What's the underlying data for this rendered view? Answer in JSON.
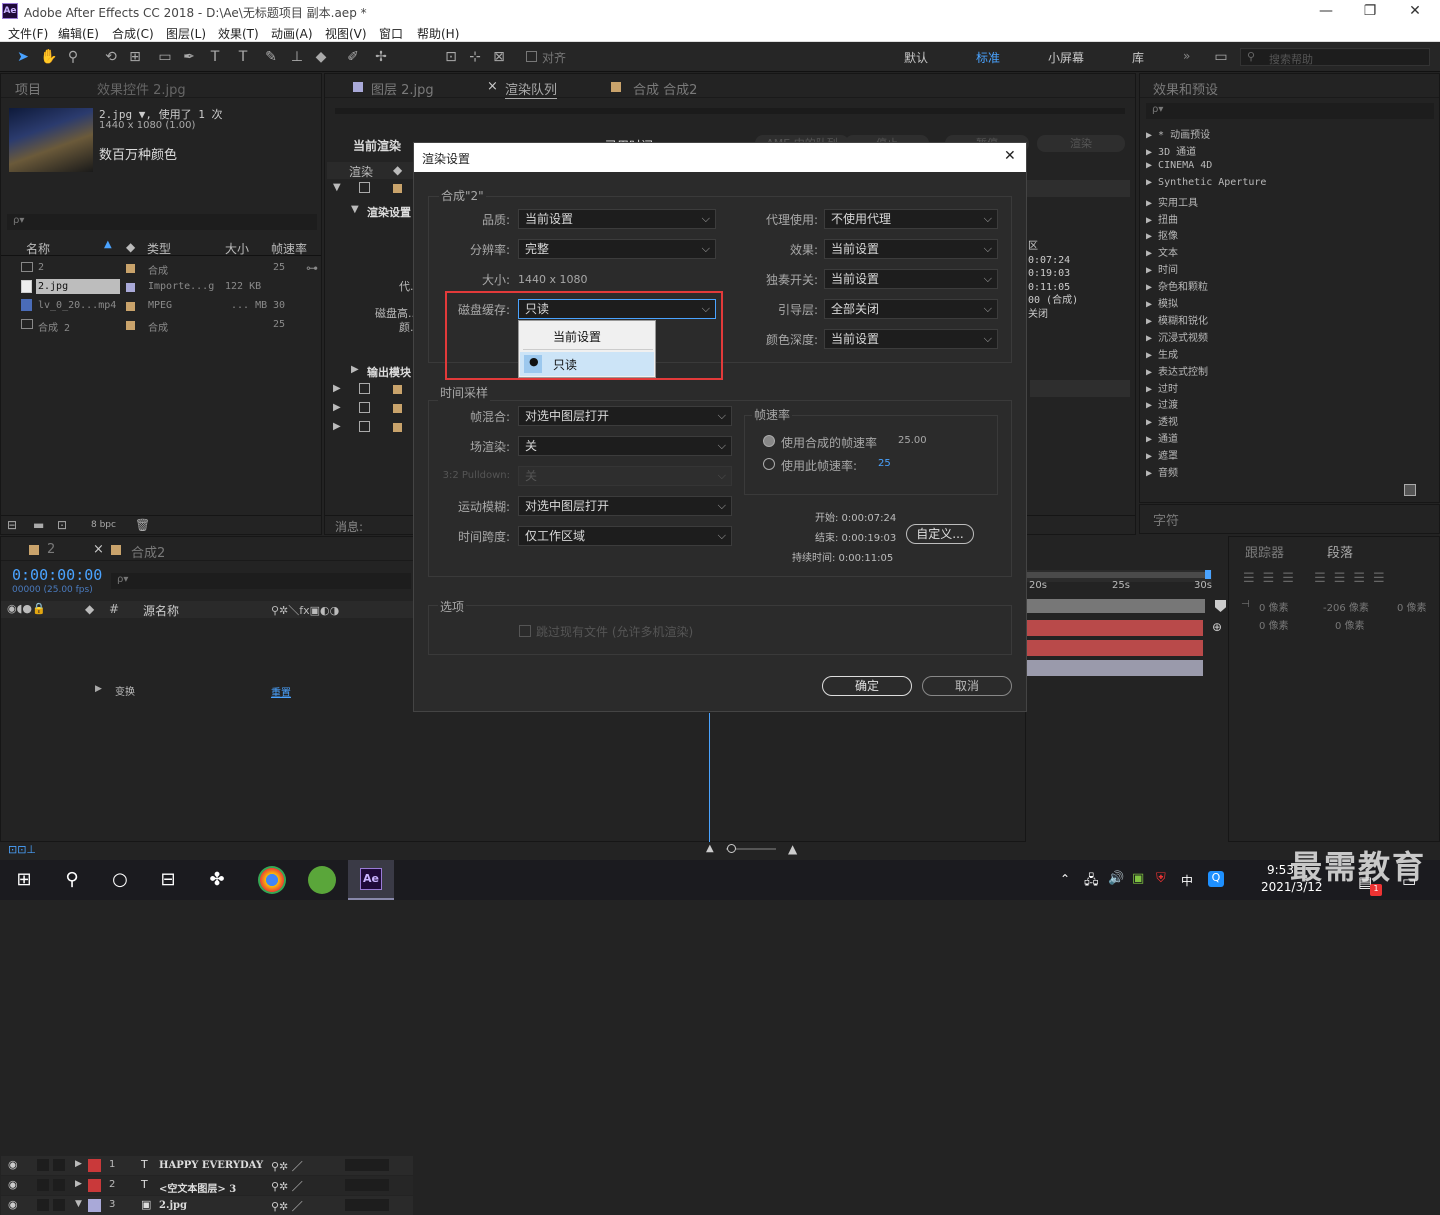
{
  "window": {
    "title": "Adobe After Effects CC 2018 - D:\\Ae\\无标题项目 副本.aep *",
    "app_icon": "Ae",
    "min": "—",
    "restore": "❐",
    "close": "✕"
  },
  "menu": [
    "文件(F)",
    "编辑(E)",
    "合成(C)",
    "图层(L)",
    "效果(T)",
    "动画(A)",
    "视图(V)",
    "窗口",
    "帮助(H)"
  ],
  "toolbar": {
    "align_label": "对齐",
    "workspaces": [
      "默认",
      "标准",
      "小屏幕",
      "库"
    ],
    "search_placeholder": "搜索帮助",
    "more": "»"
  },
  "project": {
    "tabs": [
      "项目",
      "效果控件 2.jpg"
    ],
    "file_name": "2.jpg ▼, 使用了 1 次",
    "file_size": "1440 x 1080 (1.00)",
    "file_colors": "数百万种颜色",
    "search_placeholder": "ρ▾",
    "columns": [
      "名称",
      "类型",
      "大小",
      "帧速率"
    ],
    "items": [
      {
        "name": "2",
        "type": "合成",
        "size": "",
        "fps": "25",
        "color": "#c9a36b"
      },
      {
        "name": "2.jpg",
        "type": "Importe...g",
        "size": "122 KB",
        "fps": "",
        "color": "#a9a9d8"
      },
      {
        "name": "lv_0_20...mp4",
        "type": "MPEG",
        "size": "... MB",
        "fps": "30",
        "color": "#c9a36b"
      },
      {
        "name": "合成 2",
        "type": "合成",
        "size": "",
        "fps": "25",
        "color": "#c9a36b"
      }
    ],
    "bpc": "8 bpc"
  },
  "center": {
    "tabs": [
      "图层 2.jpg",
      "渲染队列",
      "合成 合成2"
    ],
    "current_render": "当前渲染",
    "render_col": "渲染",
    "render_settings": "渲染设置",
    "output_module": "输出模块",
    "disk_label": "磁盘高...",
    "color_label": "颜...",
    "proxy_label": "代...",
    "message": "消息:",
    "time_col": "已用时间",
    "buttons": [
      "AME 中的队列",
      "停止",
      "暂停",
      "渲染"
    ],
    "right_info": [
      "区",
      "0:07:24",
      "0:19:03",
      "0:11:05",
      "00 (合成)",
      "关闭"
    ]
  },
  "effects": {
    "tab": "效果和预设",
    "search_placeholder": "ρ▾",
    "items": [
      "* 动画预设",
      "3D 通道",
      "CINEMA 4D",
      "Synthetic Aperture",
      "实用工具",
      "扭曲",
      "抠像",
      "文本",
      "时间",
      "杂色和颗粒",
      "模拟",
      "模糊和锐化",
      "沉浸式视频",
      "生成",
      "表达式控制",
      "过时",
      "过渡",
      "透视",
      "通道",
      "遮罩",
      "音频"
    ],
    "char_tab": "字符"
  },
  "timeline": {
    "tabs": [
      "2",
      "合成2"
    ],
    "timecode": "0:00:00:00",
    "timecode_sub": "00000 (25.00 fps)",
    "columns": [
      "#",
      "源名称"
    ],
    "layers": [
      {
        "num": "1",
        "type": "T",
        "name": "HAPPY EVERYDAY",
        "color": "#c9393a"
      },
      {
        "num": "2",
        "type": "T",
        "name": "<空文本图层> 3",
        "color": "#c9393a"
      },
      {
        "num": "3",
        "type": "▣",
        "name": "2.jpg",
        "color": "#a9a9d8"
      }
    ],
    "transform": "变换",
    "reset": "重置",
    "ruler": [
      "20s",
      "25s",
      "30s"
    ]
  },
  "tracker": {
    "tabs": [
      "跟踪器",
      "段落"
    ],
    "values": [
      "0 像素",
      "-206 像素",
      "0 像素",
      "0 像素",
      "0 像素"
    ]
  },
  "dialog": {
    "title": "渲染设置",
    "close": "✕",
    "comp_group": "合成\"2\"",
    "left_fields": [
      {
        "label": "品质:",
        "value": "当前设置"
      },
      {
        "label": "分辨率:",
        "value": "完整"
      }
    ],
    "size_label": "大小:",
    "size_value": "1440 x 1080",
    "disk_label": "磁盘缓存:",
    "disk_value": "只读",
    "right_fields": [
      {
        "label": "代理使用:",
        "value": "不使用代理"
      },
      {
        "label": "效果:",
        "value": "当前设置"
      },
      {
        "label": "独奏开关:",
        "value": "当前设置"
      },
      {
        "label": "引导层:",
        "value": "全部关闭"
      },
      {
        "label": "颜色深度:",
        "value": "当前设置"
      }
    ],
    "dropdown_options": [
      "当前设置",
      "只读"
    ],
    "time_group": "时间采样",
    "time_fields": [
      {
        "label": "帧混合:",
        "value": "对选中图层打开"
      },
      {
        "label": "场渲染:",
        "value": "关"
      },
      {
        "label": "3:2 Pulldown:",
        "value": "关"
      },
      {
        "label": "运动模糊:",
        "value": "对选中图层打开"
      },
      {
        "label": "时间跨度:",
        "value": "仅工作区域"
      }
    ],
    "fps_group": "帧速率",
    "fps_opt1": "使用合成的帧速率",
    "fps_opt1_val": "25.00",
    "fps_opt2": "使用此帧速率:",
    "fps_opt2_val": "25",
    "start": "开始: 0:00:07:24",
    "end": "结束: 0:00:19:03",
    "duration": "持续时间: 0:00:11:05",
    "custom_btn": "自定义...",
    "options_group": "选项",
    "skip_label": "跳过现有文件 (允许多机渲染)",
    "ok": "确定",
    "cancel": "取消"
  },
  "taskbar": {
    "time": "9:53",
    "date": "2021/3/12",
    "ime": "中",
    "notif": "1"
  },
  "watermark": "最需教育"
}
